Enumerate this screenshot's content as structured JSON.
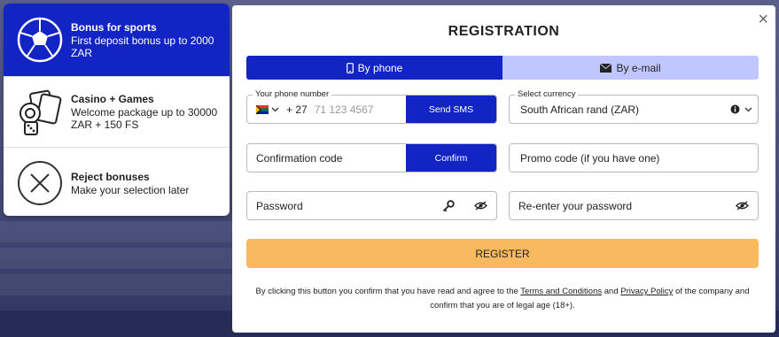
{
  "bonuses": [
    {
      "title": "Bonus for sports",
      "desc": "First deposit bonus up to 2000 ZAR",
      "icon": "soccer-ball-icon",
      "active": true
    },
    {
      "title": "Casino + Games",
      "desc": "Welcome package up to 30000 ZAR + 150 FS",
      "icon": "casino-cards-icon",
      "active": false
    },
    {
      "title": "Reject bonuses",
      "desc": "Make your selection later",
      "icon": "reject-x-icon",
      "active": false
    }
  ],
  "modal": {
    "title": "REGISTRATION",
    "close": "×",
    "tabs": {
      "phone": "By phone",
      "email": "By e-mail"
    },
    "phone": {
      "label": "Your phone number",
      "prefix": "+ 27",
      "placeholder": "71 123 4567",
      "send_sms": "Send SMS"
    },
    "currency": {
      "label": "Select currency",
      "value": "South African rand (ZAR)"
    },
    "confirmation": {
      "placeholder": "Confirmation code",
      "button": "Confirm"
    },
    "promo": {
      "placeholder": "Promo code (if you have one)"
    },
    "password": {
      "placeholder": "Password"
    },
    "repassword": {
      "placeholder": "Re-enter your password"
    },
    "register": "REGISTER",
    "disclaimer": {
      "part1": "By clicking this button you confirm that you have read and agree to the",
      "terms": "Terms and Conditions",
      "and": "and",
      "privacy": "Privacy Policy",
      "part2": "of the company and confirm that you are of legal age (18+)."
    }
  },
  "colors": {
    "primary": "#1324c5",
    "tab_inactive": "#c0c6ff",
    "register": "#f8b95f"
  }
}
